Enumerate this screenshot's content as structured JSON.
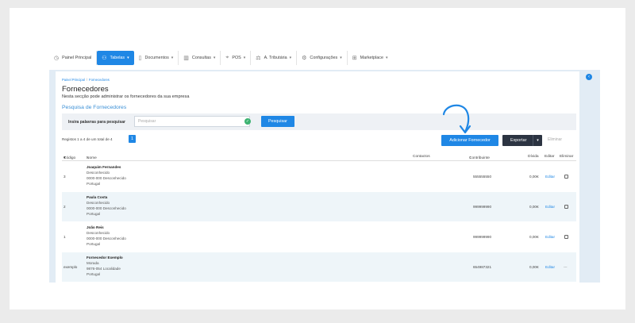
{
  "nav": [
    {
      "label": "Painel Principal",
      "icon": "dashboard-icon",
      "active": false,
      "dropdown": false
    },
    {
      "label": "Tabelas",
      "icon": "users-icon",
      "active": true,
      "dropdown": true
    },
    {
      "label": "Documentos",
      "icon": "document-icon",
      "active": false,
      "dropdown": true
    },
    {
      "label": "Consultas",
      "icon": "chart-icon",
      "active": false,
      "dropdown": true
    },
    {
      "label": "POS",
      "icon": "pos-icon",
      "active": false,
      "dropdown": true
    },
    {
      "label": "A. Tributária",
      "icon": "tax-icon",
      "active": false,
      "dropdown": true
    },
    {
      "label": "Configurações",
      "icon": "settings-icon",
      "active": false,
      "dropdown": true
    },
    {
      "label": "Marketplace",
      "icon": "marketplace-icon",
      "active": false,
      "dropdown": true
    }
  ],
  "breadcrumb": {
    "home": "Painel Principal",
    "current": "Fornecedores"
  },
  "page": {
    "title": "Fornecedores",
    "description": "Nesta secção pode administrar os fornecedores da sua empresa"
  },
  "search": {
    "title": "Pesquisa de Fornecedores",
    "label": "Insira palavras para pesquisar",
    "placeholder": "Pesquisar",
    "button": "Pesquisar"
  },
  "toolbar": {
    "records": "Registos 1 a 4 de um total de 4",
    "page": "1",
    "add": "Adicionar Fornecedor",
    "export": "Exportar",
    "delete": "Eliminar"
  },
  "table": {
    "headers": {
      "code": "Código",
      "name": "Nome",
      "contacts": "Contactos",
      "nif": "Contribuinte",
      "debt": "Dívida",
      "edit": "Editar",
      "delete": "Eliminar"
    },
    "rows": [
      {
        "code": "3",
        "name": "Joaquim Fernandes",
        "line1": "Desconhecido",
        "line2": "0000-000 Desconhecido",
        "country": "Portugal",
        "nif": "555555550",
        "debt": "0,00€",
        "edit": "Editar",
        "delete_mark": "checkbox"
      },
      {
        "code": "2",
        "name": "Paula Costa",
        "line1": "Desconhecido",
        "line2": "0000-000 Desconhecido",
        "country": "Portugal",
        "nif": "999999990",
        "debt": "0,00€",
        "edit": "Editar",
        "delete_mark": "checkbox"
      },
      {
        "code": "1",
        "name": "João Reis",
        "line1": "Desconhecido",
        "line2": "0000-000 Desconhecido",
        "country": "Portugal",
        "nif": "999999990",
        "debt": "0,00€",
        "edit": "Editar",
        "delete_mark": "checkbox"
      },
      {
        "code": "exemplo",
        "name": "Fornecedor Exemplo",
        "line1": "Morada",
        "line2": "9876-054 Localidade",
        "country": "Portugal",
        "nif": "654987321",
        "debt": "0,00€",
        "edit": "Editar",
        "delete_mark": "---"
      }
    ]
  },
  "colors": {
    "accent": "#1f87e5",
    "dark": "#2c3442",
    "alt_row": "#eef5f9"
  }
}
